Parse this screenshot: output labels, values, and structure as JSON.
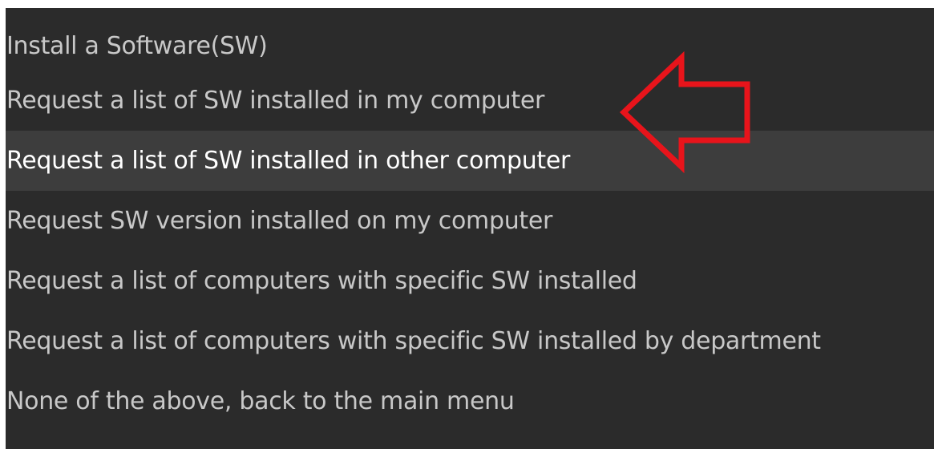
{
  "menu": {
    "items": [
      {
        "label": "Install a Software(SW)",
        "highlighted": false
      },
      {
        "label": "Request a list of SW installed in my computer",
        "highlighted": false
      },
      {
        "label": "Request a list of SW installed in other computer",
        "highlighted": true
      },
      {
        "label": "Request SW version installed on my computer",
        "highlighted": false
      },
      {
        "label": "Request a list of computers with specific SW installed",
        "highlighted": false
      },
      {
        "label": "Request a list of computers with specific SW installed by department",
        "highlighted": false
      },
      {
        "label": "None of the above, back to the main menu",
        "highlighted": false
      }
    ]
  },
  "callout": {
    "icon": "left-arrow-outline-icon",
    "color": "#e8141b"
  },
  "colors": {
    "background": "#2b2b2b",
    "highlight_background": "#3d3d3d",
    "text": "#c8c8c8",
    "highlight_text": "#ffffff"
  }
}
